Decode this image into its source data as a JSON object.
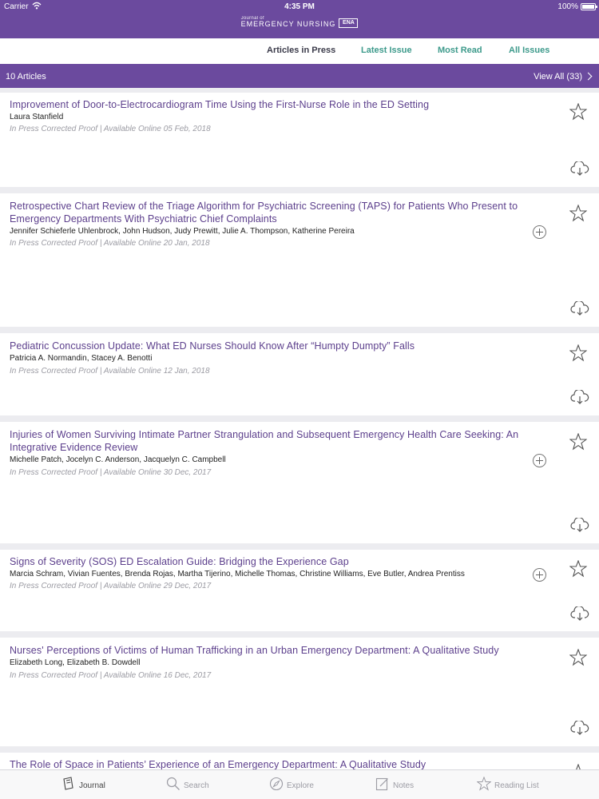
{
  "status_bar": {
    "carrier": "Carrier",
    "time": "4:35 PM",
    "battery": "100%"
  },
  "header": {
    "logo_small": "Journal of",
    "logo_big": "EMERGENCY NURSING",
    "logo_badge": "ENA"
  },
  "tabs": [
    {
      "label": "Articles in Press",
      "active": true
    },
    {
      "label": "Latest Issue",
      "active": false
    },
    {
      "label": "Most Read",
      "active": false
    },
    {
      "label": "All Issues",
      "active": false
    }
  ],
  "list_header": {
    "count": "10 Articles",
    "view_all": "View All (33)"
  },
  "articles": [
    {
      "title": "Improvement of Door-to-Electrocardiogram Time Using the First-Nurse Role in the ED Setting",
      "authors": "Laura Stanfield",
      "meta": "In Press Corrected Proof | Available Online 05 Feb, 2018",
      "has_more": false
    },
    {
      "title": "Retrospective Chart Review of the Triage Algorithm for Psychiatric Screening (TAPS) for Patients Who Present to Emergency Departments With Psychiatric Chief Complaints",
      "authors": "Jennifer Schieferle Uhlenbrock, John Hudson, Judy Prewitt, Julie A. Thompson, Katherine Pereira",
      "meta": "In Press Corrected Proof | Available Online 20 Jan, 2018",
      "has_more": true
    },
    {
      "title": "Pediatric Concussion Update: What ED Nurses Should Know After “Humpty Dumpty” Falls",
      "authors": "Patricia A. Normandin, Stacey A. Benotti",
      "meta": "In Press Corrected Proof | Available Online 12 Jan, 2018",
      "has_more": false
    },
    {
      "title": "Injuries of Women Surviving Intimate Partner Strangulation and Subsequent Emergency Health Care Seeking: An Integrative Evidence Review",
      "authors": "Michelle Patch, Jocelyn C. Anderson, Jacquelyn C. Campbell",
      "meta": "In Press Corrected Proof | Available Online 30 Dec, 2017",
      "has_more": true
    },
    {
      "title": "Signs of Severity (SOS) ED Escalation Guide: Bridging the Experience Gap",
      "authors": "Marcia Schram, Vivian Fuentes, Brenda Rojas, Martha Tijerino, Michelle Thomas, Christine Williams, Eve Butler, Andrea Prentiss",
      "meta": "In Press Corrected Proof | Available Online 29 Dec, 2017",
      "has_more": true
    },
    {
      "title": "Nurses' Perceptions of Victims of Human Trafficking in an Urban Emergency Department: A Qualitative Study",
      "authors": "Elizabeth Long, Elizabeth B. Dowdell",
      "meta": "In Press Corrected Proof | Available Online 16 Dec, 2017",
      "has_more": false
    },
    {
      "title": "The Role of Space in Patients’ Experience of an Emergency Department: A Qualitative Study",
      "authors": "",
      "meta": "",
      "has_more": false
    }
  ],
  "bottom_tabs": [
    {
      "label": "Journal",
      "icon": "journal-icon",
      "active": true
    },
    {
      "label": "Search",
      "icon": "search-icon",
      "active": false
    },
    {
      "label": "Explore",
      "icon": "compass-icon",
      "active": false
    },
    {
      "label": "Notes",
      "icon": "notes-icon",
      "active": false
    },
    {
      "label": "Reading List",
      "icon": "star-icon",
      "active": false
    }
  ],
  "colors": {
    "brand_purple": "#6b4a9e",
    "tab_teal": "#3d9a8b",
    "title_purple": "#5c3f8c"
  }
}
